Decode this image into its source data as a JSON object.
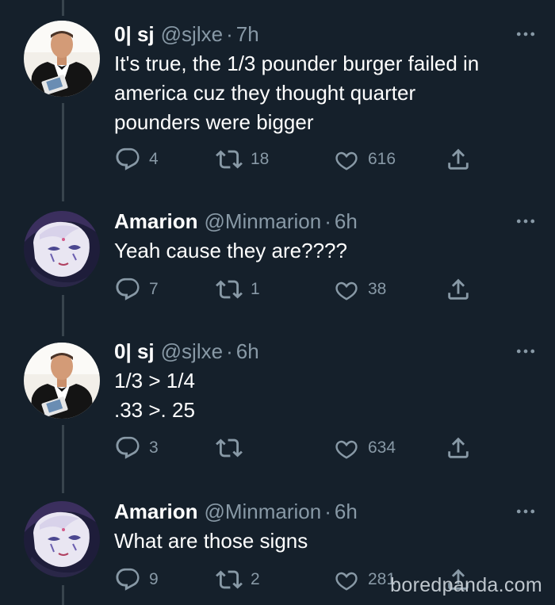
{
  "tweets": [
    {
      "name": "0| sj",
      "handle": "@sjlxe",
      "separator": "·",
      "time": "7h",
      "avatar": "man-in-tuxedo-avatar",
      "lines": [
        "It's true, the 1/3 pounder burger failed in",
        "america cuz they thought quarter",
        "pounders were bigger"
      ],
      "replies": "4",
      "retweets": "18",
      "likes": "616"
    },
    {
      "name": "Amarion",
      "handle": "@Minmarion",
      "separator": "·",
      "time": "6h",
      "avatar": "anime-character-avatar",
      "lines": [
        "Yeah cause they are????"
      ],
      "replies": "7",
      "retweets": "1",
      "likes": "38"
    },
    {
      "name": "0| sj",
      "handle": "@sjlxe",
      "separator": "·",
      "time": "6h",
      "avatar": "man-in-tuxedo-avatar",
      "lines": [
        "1/3 > 1/4",
        ".33 >. 25"
      ],
      "replies": "3",
      "retweets": "",
      "likes": "634"
    },
    {
      "name": "Amarion",
      "handle": "@Minmarion",
      "separator": "·",
      "time": "6h",
      "avatar": "anime-character-avatar",
      "lines": [
        "What are those signs"
      ],
      "replies": "9",
      "retweets": "2",
      "likes": "281"
    }
  ],
  "icons": {
    "reply": "reply-icon",
    "retweet": "retweet-icon",
    "like": "heart-icon",
    "share": "share-icon",
    "more": "more-options-icon"
  },
  "colors": {
    "background": "#15202b",
    "text": "#ffffff",
    "secondary": "#8899a6",
    "thread_line": "#38444d"
  },
  "watermark": "boredpanda.com"
}
